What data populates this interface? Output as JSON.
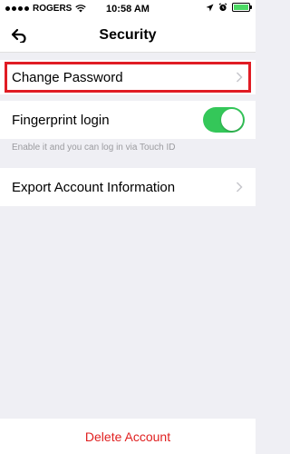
{
  "status_bar": {
    "carrier": "ROGERS",
    "time": "10:58 AM",
    "battery_level": 1.0
  },
  "nav": {
    "title": "Security",
    "back_icon": "back-arrow-icon"
  },
  "rows": {
    "change_password": {
      "label": "Change Password",
      "highlighted": true,
      "highlight_color": "#e01c24"
    },
    "fingerprint": {
      "label": "Fingerprint login",
      "enabled": true,
      "toggle_color": "#34c759",
      "hint": "Enable it and you can log in via Touch ID"
    },
    "export": {
      "label": "Export Account Information"
    }
  },
  "footer": {
    "delete_label": "Delete Account",
    "delete_color": "#e02020"
  }
}
